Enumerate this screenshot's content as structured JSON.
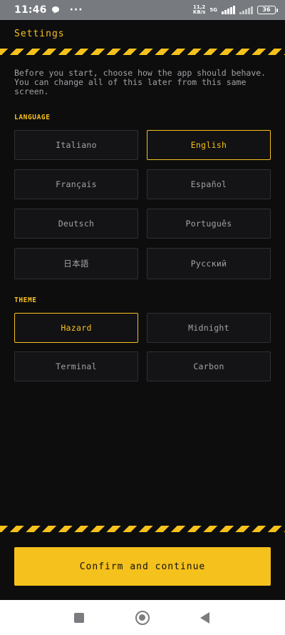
{
  "status_bar": {
    "time": "11:46",
    "more": "···",
    "speed_value": "11,2",
    "speed_unit": "KB/s",
    "network": "5G",
    "battery": "36"
  },
  "header": {
    "title": "Settings"
  },
  "intro": "Before you start, choose how the app should behave. You can change all of this later from this same screen.",
  "language": {
    "label": "LANGUAGE",
    "options": [
      "Italiano",
      "English",
      "Français",
      "Español",
      "Deutsch",
      "Português",
      "日本語",
      "Русский"
    ],
    "selected": "English"
  },
  "theme": {
    "label": "THEME",
    "options": [
      "Hazard",
      "Midnight",
      "Terminal",
      "Carbon"
    ],
    "selected": "Hazard"
  },
  "confirm_label": "Confirm and continue",
  "colors": {
    "accent": "#f5c11c",
    "background": "#0d0d0e",
    "tile": "#141417",
    "tile_border": "#303034"
  },
  "icons": {
    "nav_recent": "square-icon",
    "nav_home": "home-circle-icon",
    "nav_back": "back-triangle-icon"
  }
}
